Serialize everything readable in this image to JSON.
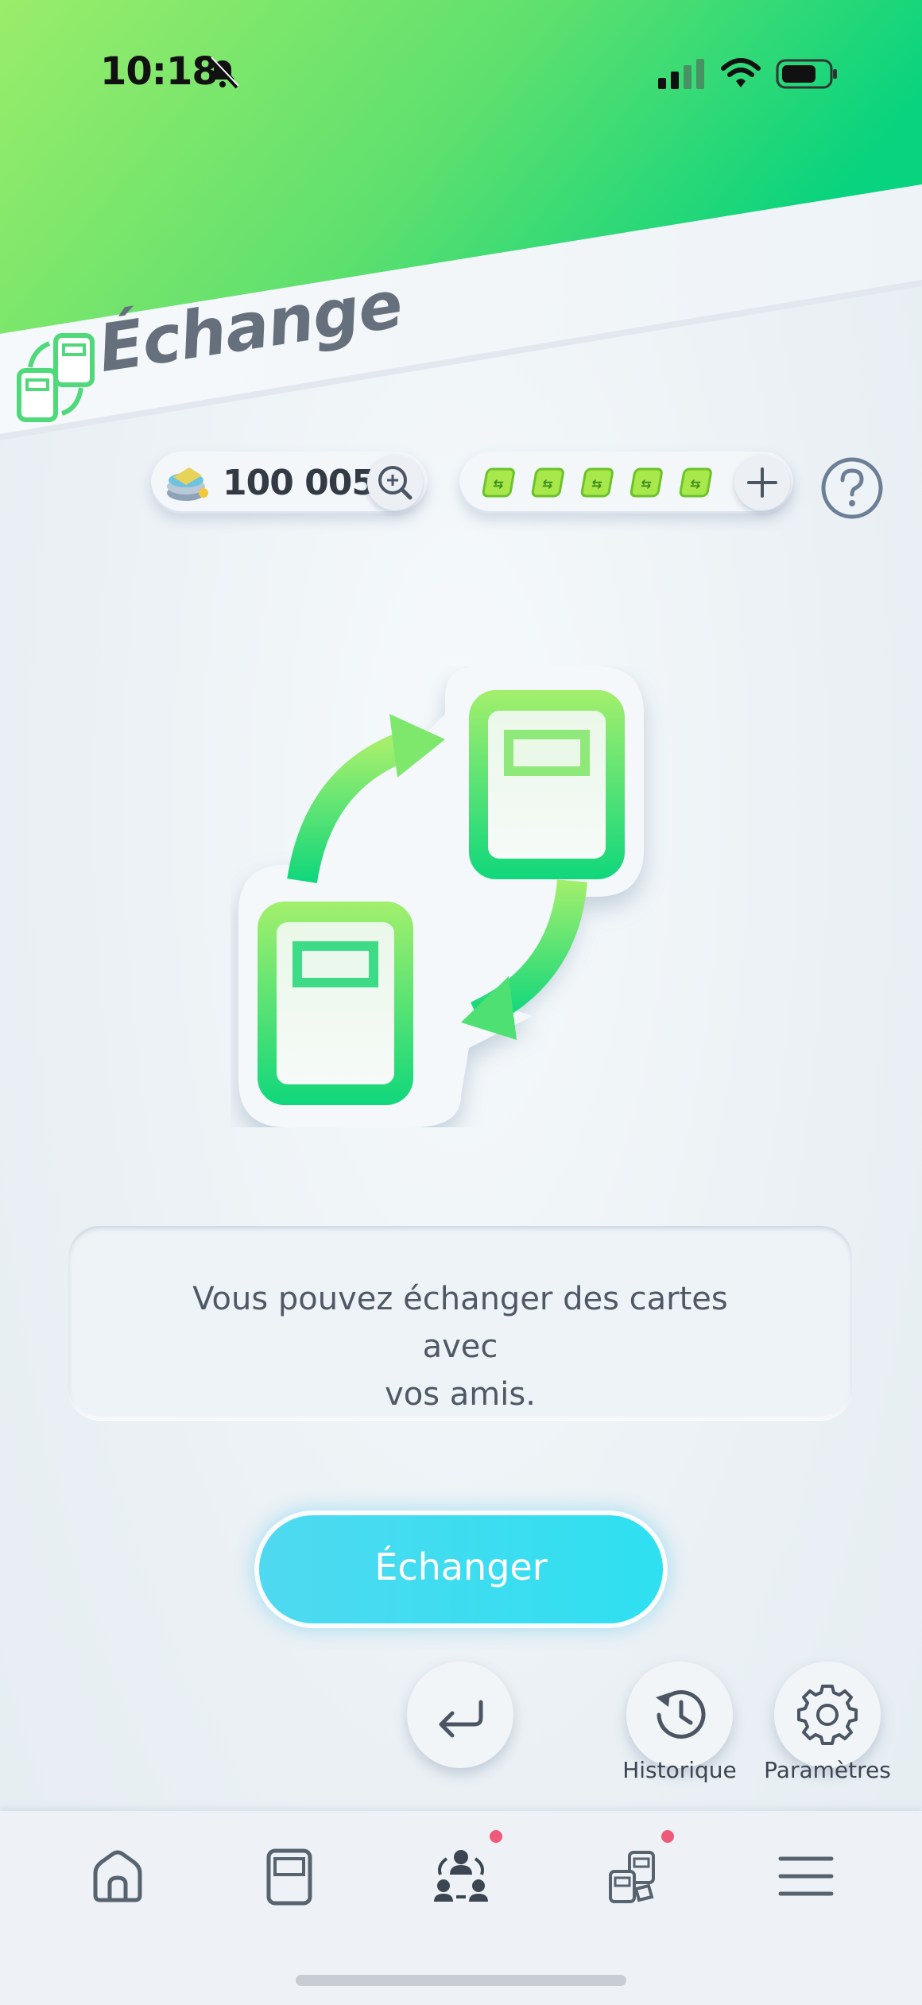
{
  "status_bar": {
    "time": "10:18",
    "icons": [
      "bell-muted-icon",
      "cellular-signal-icon",
      "wifi-icon",
      "battery-icon"
    ]
  },
  "header": {
    "title": "Échange",
    "accent_gradient": [
      "#9aed6a",
      "#08d37e"
    ]
  },
  "currency": {
    "coins_value": "100 005",
    "coin_icon": "coin-stack-icon",
    "zoom_icon": "zoom-in-icon",
    "tickets": [
      "trade-ticket-icon",
      "trade-ticket-icon",
      "trade-ticket-icon",
      "trade-ticket-icon",
      "trade-ticket-icon"
    ],
    "add_icon": "plus-icon",
    "help_icon": "help-icon"
  },
  "hero": {
    "icon": "card-swap-icon",
    "color_top": "#a3ef6c",
    "color_bottom": "#10d77c"
  },
  "info": {
    "message_line1": "Vous pouvez échanger des cartes avec",
    "message_line2": "vos amis."
  },
  "primary_action": {
    "label": "Échanger",
    "color": "#3fdcf0"
  },
  "actions": {
    "back_icon": "return-icon",
    "history_label": "Historique",
    "history_icon": "history-clock-icon",
    "settings_label": "Paramètres",
    "settings_icon": "gear-icon"
  },
  "bottom_nav": {
    "items": [
      {
        "icon": "home-icon",
        "active": false,
        "badge": false
      },
      {
        "icon": "card-icon",
        "active": false,
        "badge": false
      },
      {
        "icon": "trade-people-icon",
        "active": true,
        "badge": true
      },
      {
        "icon": "social-cards-icon",
        "active": false,
        "badge": true
      },
      {
        "icon": "menu-icon",
        "active": false,
        "badge": false
      }
    ],
    "badge_color": "#ef5a7a"
  }
}
